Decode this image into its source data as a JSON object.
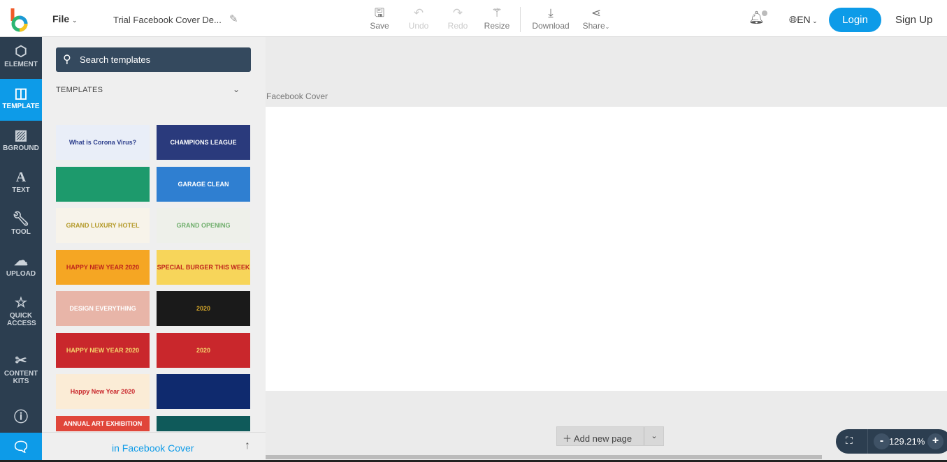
{
  "header": {
    "file_label": "File",
    "doc_title": "Trial Facebook Cover De...",
    "toolbar": [
      {
        "label": "Save",
        "icon": "save-icon",
        "enabled": true
      },
      {
        "label": "Undo",
        "icon": "undo-icon",
        "enabled": false
      },
      {
        "label": "Redo",
        "icon": "redo-icon",
        "enabled": false
      },
      {
        "label": "Resize",
        "icon": "magic-wand-icon",
        "enabled": true
      },
      {
        "label": "Download",
        "icon": "download-icon",
        "enabled": true
      },
      {
        "label": "Share",
        "icon": "share-icon",
        "enabled": true
      }
    ],
    "language": "EN",
    "login": "Login",
    "signup": "Sign Up"
  },
  "sidebar": {
    "items": [
      {
        "label": "ELEMENT",
        "icon": "shapes-icon"
      },
      {
        "label": "TEMPLATE",
        "icon": "template-icon",
        "active": true
      },
      {
        "label": "BGROUND",
        "icon": "background-icon"
      },
      {
        "label": "TEXT",
        "icon": "text-icon"
      },
      {
        "label": "TOOL",
        "icon": "wrench-icon"
      },
      {
        "label": "UPLOAD",
        "icon": "cloud-upload-icon"
      },
      {
        "label": "QUICK ACCESS",
        "icon": "star-icon"
      },
      {
        "label": "CONTENT KITS",
        "icon": "tools-icon"
      }
    ]
  },
  "panel": {
    "search_placeholder": "Search templates",
    "section": "TEMPLATES",
    "footer": "in Facebook Cover",
    "templates": [
      {
        "text": "What is Corona Virus?",
        "bg": "#e9eef8",
        "fg": "#2c3e8c"
      },
      {
        "text": "CHAMPIONS LEAGUE",
        "bg": "#2a3a7c",
        "fg": "#fff"
      },
      {
        "text": "",
        "bg": "#1d9a6c",
        "fg": "#fff"
      },
      {
        "text": "GARAGE CLEAN",
        "bg": "#2f7fd1",
        "fg": "#fff"
      },
      {
        "text": "GRAND LUXURY HOTEL",
        "bg": "#f7f3ea",
        "fg": "#b49a2a"
      },
      {
        "text": "GRAND OPENING",
        "bg": "#eef0ea",
        "fg": "#6fae6c"
      },
      {
        "text": "HAPPY NEW YEAR 2020",
        "bg": "#f5a623",
        "fg": "#c0261c"
      },
      {
        "text": "SPECIAL BURGER THIS WEEK",
        "bg": "#f7d55a",
        "fg": "#c0261c"
      },
      {
        "text": "DESIGN EVERYTHING",
        "bg": "#e8b5a8",
        "fg": "#fff"
      },
      {
        "text": "2020",
        "bg": "#1a1a1a",
        "fg": "#d4a62a"
      },
      {
        "text": "HAPPY NEW YEAR 2020",
        "bg": "#c9272c",
        "fg": "#f5d36b"
      },
      {
        "text": "2020",
        "bg": "#c9272c",
        "fg": "#f5d36b"
      },
      {
        "text": "Happy New Year 2020",
        "bg": "#fbecd6",
        "fg": "#c9272c"
      },
      {
        "text": "",
        "bg": "#0f2a6e",
        "fg": "#fff"
      },
      {
        "text": "ANNUAL ART EXHIBITION",
        "bg": "#e0463a",
        "fg": "#fff"
      },
      {
        "text": "",
        "bg": "#0f5a5a",
        "fg": "#fff"
      }
    ]
  },
  "canvas": {
    "page_label": "Facebook Cover",
    "add_page": "Add new page",
    "zoom": "129.21%"
  }
}
